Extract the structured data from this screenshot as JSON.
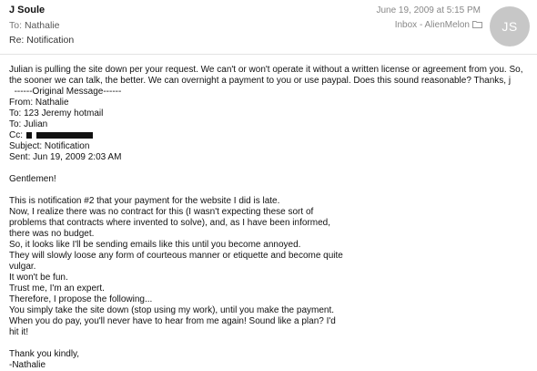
{
  "header": {
    "from": "J Soule",
    "to_label": "To:",
    "to_value": "Nathalie",
    "subject": "Re: Notification",
    "date": "June 19, 2009 at 5:15 PM",
    "mailbox": "Inbox - AlienMelon",
    "avatar_initials": "JS"
  },
  "body": {
    "reply_paragraph": "Julian is pulling the site down per your request.  We can't or won't operate it without a written license or agreement from you.  So, the sooner we can talk, the better.  We can overnight a payment to you or use paypal.  Does this sound reasonable?  Thanks, j",
    "original_marker": "------Original Message------",
    "orig_from": "From: Nathalie",
    "orig_to": "To: 123 Jeremy hotmail",
    "orig_to_julian": "To: Julian",
    "orig_cc": "Cc:",
    "orig_subject": "Subject: Notification",
    "orig_sent": "Sent: Jun 19, 2009 2:03 AM",
    "greeting": "Gentlemen!",
    "lines": [
      "This is notification #2 that your payment for the website I did is late.",
      "Now, I realize there was no contract for this (I wasn't expecting these sort of",
      "problems that contracts where invented to solve), and, as I have been informed,",
      "there was no budget.",
      "So, it looks like I'll be sending emails like this until you become annoyed.",
      "They will slowly loose any form of courteous manner or etiquette and become quite",
      "vulgar.",
      "It won't be fun.",
      "Trust me, I'm an expert.",
      "Therefore, I propose the following...",
      "You simply take the site down (stop using my work), until you make the payment.",
      "When you do pay, you'll never have to hear from me again! Sound like a plan? I'd",
      "hit it!"
    ],
    "closing": "Thank you kindly,",
    "signature": "-Nathalie"
  },
  "icons": {
    "mailbox": "folder-icon"
  },
  "colors": {
    "avatar_bg": "#c7c7c7",
    "meta_text": "#888888"
  }
}
